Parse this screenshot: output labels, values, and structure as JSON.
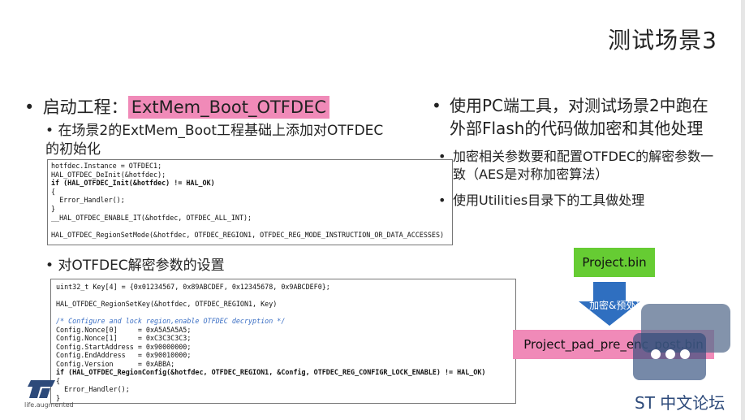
{
  "title": "测试场景3",
  "left": {
    "bullet1_label": "启动工程：",
    "bullet1_project": "ExtMem_Boot_OTFDEC",
    "sub1_text": "在场景2的ExtMem_Boot工程基础上添加对OTFDEC的初始化",
    "sub2_text": "对OTFDEC解密参数的设置"
  },
  "code1": {
    "lines": [
      "hotfdec.Instance = OTFDEC1;",
      "HAL_OTFDEC_DeInit(&hotfdec);",
      "if (HAL_OTFDEC_Init(&hotfdec) != HAL_OK)",
      "{",
      "  Error_Handler();",
      "}",
      "__HAL_OTFDEC_ENABLE_IT(&hotfdec, OTFDEC_ALL_INT);",
      "",
      "HAL_OTFDEC_RegionSetMode(&hotfdec, OTFDEC_REGION1, OTFDEC_REG_MODE_INSTRUCTION_OR_DATA_ACCESSES)"
    ]
  },
  "code2": {
    "lines": [
      "uint32_t Key[4] = {0x01234567, 0x89ABCDEF, 0x12345678, 0x9ABCDEF0};",
      "",
      "HAL_OTFDEC_RegionSetKey(&hotfdec, OTFDEC_REGION1, Key)",
      "",
      "/* Configure and lock region,enable OTFDEC decryption */",
      "Config.Nonce[0]     = 0xA5A5A5A5;",
      "Config.Nonce[1]     = 0xC3C3C3C3;",
      "Config.StartAddress = 0x90000000;",
      "Config.EndAddress   = 0x90010000;",
      "Config.Version      = 0xABBA;",
      "if (HAL_OTFDEC_RegionConfig(&hotfdec, OTFDEC_REGION1, &Config, OTFDEC_REG_CONFIGR_LOCK_ENABLE) != HAL_OK)",
      "{",
      "  Error_Handler();",
      "}"
    ]
  },
  "right": {
    "bullet1": "使用PC端工具，对测试场景2中跑在外部Flash的代码做加密和其他处理",
    "sub1": "加密相关参数要和配置OTFDEC的解密参数一致（AES是对称加密算法）",
    "sub2": "使用Utilities目录下的工具做处理"
  },
  "flow": {
    "input_box": "Project.bin",
    "arrow_label": "加密&预处理",
    "output_box": "Project_pad_pre_enc_post.bin"
  },
  "brand": {
    "logo_tagline": "life.augmented",
    "watermark_text": "ST 中文论坛"
  },
  "colors": {
    "highlight": "#f08ab8",
    "green_box": "#66cc33",
    "arrow": "#2f6fc0",
    "watermark": "#2d4a7a"
  }
}
